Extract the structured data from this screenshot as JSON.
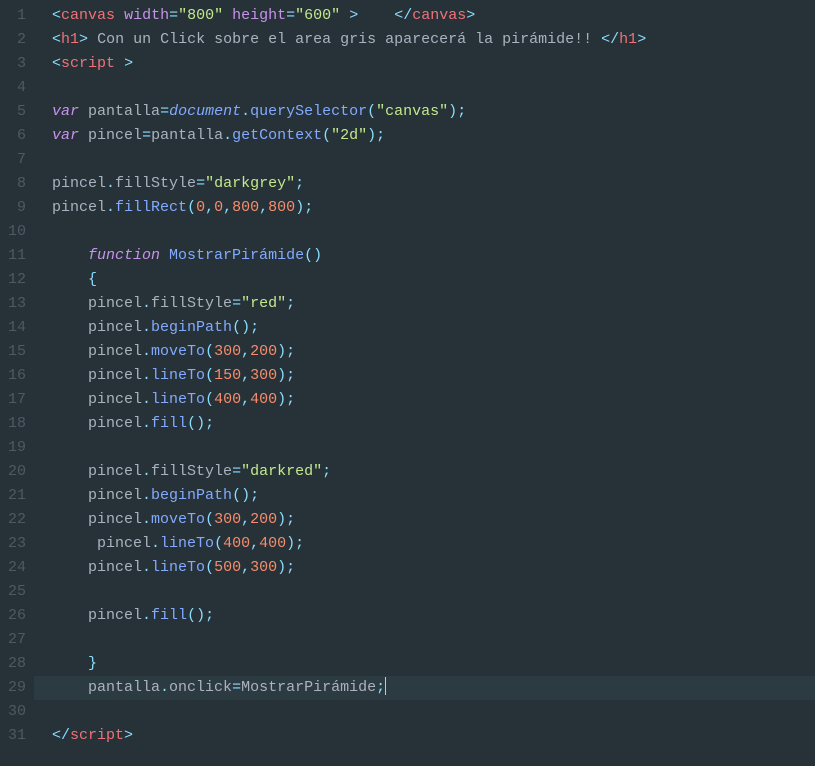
{
  "lineCount": 31,
  "currentLine": 29,
  "lines": [
    [
      [
        "ws",
        "  "
      ],
      [
        "punct",
        "<"
      ],
      [
        "tag",
        "canvas"
      ],
      [
        "text",
        " "
      ],
      [
        "attrn",
        "width"
      ],
      [
        "punct",
        "="
      ],
      [
        "string",
        "\"800\""
      ],
      [
        "text",
        " "
      ],
      [
        "attrn",
        "height"
      ],
      [
        "punct",
        "="
      ],
      [
        "string",
        "\"600\""
      ],
      [
        "text",
        " "
      ],
      [
        "punct",
        ">"
      ],
      [
        "text",
        "    "
      ],
      [
        "punct",
        "</"
      ],
      [
        "tag",
        "canvas"
      ],
      [
        "punct",
        ">"
      ]
    ],
    [
      [
        "ws",
        "  "
      ],
      [
        "punct",
        "<"
      ],
      [
        "tag",
        "h1"
      ],
      [
        "punct",
        ">"
      ],
      [
        "text",
        " Con un Click sobre el area gris aparecerá la pirámide!! "
      ],
      [
        "punct",
        "</"
      ],
      [
        "tag",
        "h1"
      ],
      [
        "punct",
        ">"
      ]
    ],
    [
      [
        "ws",
        "  "
      ],
      [
        "punct",
        "<"
      ],
      [
        "tag",
        "script"
      ],
      [
        "text",
        " "
      ],
      [
        "punct",
        ">"
      ]
    ],
    [],
    [
      [
        "ws",
        "  "
      ],
      [
        "kw",
        "var"
      ],
      [
        "text",
        " "
      ],
      [
        "def",
        "pantalla"
      ],
      [
        "punct",
        "="
      ],
      [
        "builtin",
        "document"
      ],
      [
        "punct",
        "."
      ],
      [
        "method",
        "querySelector"
      ],
      [
        "punct",
        "("
      ],
      [
        "string",
        "\"canvas\""
      ],
      [
        "punct",
        ")"
      ],
      [
        "punct",
        ";"
      ]
    ],
    [
      [
        "ws",
        "  "
      ],
      [
        "kw",
        "var"
      ],
      [
        "text",
        " "
      ],
      [
        "def",
        "pincel"
      ],
      [
        "punct",
        "="
      ],
      [
        "def",
        "pantalla"
      ],
      [
        "punct",
        "."
      ],
      [
        "method",
        "getContext"
      ],
      [
        "punct",
        "("
      ],
      [
        "string",
        "\"2d\""
      ],
      [
        "punct",
        ")"
      ],
      [
        "punct",
        ";"
      ]
    ],
    [],
    [
      [
        "ws",
        "  "
      ],
      [
        "def",
        "pincel"
      ],
      [
        "punct",
        "."
      ],
      [
        "prop",
        "fillStyle"
      ],
      [
        "punct",
        "="
      ],
      [
        "string",
        "\"darkgrey\""
      ],
      [
        "punct",
        ";"
      ]
    ],
    [
      [
        "ws",
        "  "
      ],
      [
        "def",
        "pincel"
      ],
      [
        "punct",
        "."
      ],
      [
        "method",
        "fillRect"
      ],
      [
        "punct",
        "("
      ],
      [
        "number",
        "0"
      ],
      [
        "punct",
        ","
      ],
      [
        "number",
        "0"
      ],
      [
        "punct",
        ","
      ],
      [
        "number",
        "800"
      ],
      [
        "punct",
        ","
      ],
      [
        "number",
        "800"
      ],
      [
        "punct",
        ")"
      ],
      [
        "punct",
        ";"
      ]
    ],
    [],
    [
      [
        "ws",
        "      "
      ],
      [
        "kw",
        "function"
      ],
      [
        "text",
        " "
      ],
      [
        "funcn",
        "MostrarPirámide"
      ],
      [
        "punct",
        "("
      ],
      [
        "punct",
        ")"
      ]
    ],
    [
      [
        "ws",
        "      "
      ],
      [
        "punct",
        "{"
      ]
    ],
    [
      [
        "ws",
        "      "
      ],
      [
        "def",
        "pincel"
      ],
      [
        "punct",
        "."
      ],
      [
        "prop",
        "fillStyle"
      ],
      [
        "punct",
        "="
      ],
      [
        "string",
        "\"red\""
      ],
      [
        "punct",
        ";"
      ]
    ],
    [
      [
        "ws",
        "      "
      ],
      [
        "def",
        "pincel"
      ],
      [
        "punct",
        "."
      ],
      [
        "method",
        "beginPath"
      ],
      [
        "punct",
        "("
      ],
      [
        "punct",
        ")"
      ],
      [
        "punct",
        ";"
      ]
    ],
    [
      [
        "ws",
        "      "
      ],
      [
        "def",
        "pincel"
      ],
      [
        "punct",
        "."
      ],
      [
        "method",
        "moveTo"
      ],
      [
        "punct",
        "("
      ],
      [
        "number",
        "300"
      ],
      [
        "punct",
        ","
      ],
      [
        "number",
        "200"
      ],
      [
        "punct",
        ")"
      ],
      [
        "punct",
        ";"
      ]
    ],
    [
      [
        "ws",
        "      "
      ],
      [
        "def",
        "pincel"
      ],
      [
        "punct",
        "."
      ],
      [
        "method",
        "lineTo"
      ],
      [
        "punct",
        "("
      ],
      [
        "number",
        "150"
      ],
      [
        "punct",
        ","
      ],
      [
        "number",
        "300"
      ],
      [
        "punct",
        ")"
      ],
      [
        "punct",
        ";"
      ]
    ],
    [
      [
        "ws",
        "      "
      ],
      [
        "def",
        "pincel"
      ],
      [
        "punct",
        "."
      ],
      [
        "method",
        "lineTo"
      ],
      [
        "punct",
        "("
      ],
      [
        "number",
        "400"
      ],
      [
        "punct",
        ","
      ],
      [
        "number",
        "400"
      ],
      [
        "punct",
        ")"
      ],
      [
        "punct",
        ";"
      ]
    ],
    [
      [
        "ws",
        "      "
      ],
      [
        "def",
        "pincel"
      ],
      [
        "punct",
        "."
      ],
      [
        "method",
        "fill"
      ],
      [
        "punct",
        "("
      ],
      [
        "punct",
        ")"
      ],
      [
        "punct",
        ";"
      ]
    ],
    [],
    [
      [
        "ws",
        "      "
      ],
      [
        "def",
        "pincel"
      ],
      [
        "punct",
        "."
      ],
      [
        "prop",
        "fillStyle"
      ],
      [
        "punct",
        "="
      ],
      [
        "string",
        "\"darkred\""
      ],
      [
        "punct",
        ";"
      ]
    ],
    [
      [
        "ws",
        "      "
      ],
      [
        "def",
        "pincel"
      ],
      [
        "punct",
        "."
      ],
      [
        "method",
        "beginPath"
      ],
      [
        "punct",
        "("
      ],
      [
        "punct",
        ")"
      ],
      [
        "punct",
        ";"
      ]
    ],
    [
      [
        "ws",
        "      "
      ],
      [
        "def",
        "pincel"
      ],
      [
        "punct",
        "."
      ],
      [
        "method",
        "moveTo"
      ],
      [
        "punct",
        "("
      ],
      [
        "number",
        "300"
      ],
      [
        "punct",
        ","
      ],
      [
        "number",
        "200"
      ],
      [
        "punct",
        ")"
      ],
      [
        "punct",
        ";"
      ]
    ],
    [
      [
        "ws",
        "       "
      ],
      [
        "def",
        "pincel"
      ],
      [
        "punct",
        "."
      ],
      [
        "method",
        "lineTo"
      ],
      [
        "punct",
        "("
      ],
      [
        "number",
        "400"
      ],
      [
        "punct",
        ","
      ],
      [
        "number",
        "400"
      ],
      [
        "punct",
        ")"
      ],
      [
        "punct",
        ";"
      ]
    ],
    [
      [
        "ws",
        "      "
      ],
      [
        "def",
        "pincel"
      ],
      [
        "punct",
        "."
      ],
      [
        "method",
        "lineTo"
      ],
      [
        "punct",
        "("
      ],
      [
        "number",
        "500"
      ],
      [
        "punct",
        ","
      ],
      [
        "number",
        "300"
      ],
      [
        "punct",
        ")"
      ],
      [
        "punct",
        ";"
      ]
    ],
    [],
    [
      [
        "ws",
        "      "
      ],
      [
        "def",
        "pincel"
      ],
      [
        "punct",
        "."
      ],
      [
        "method",
        "fill"
      ],
      [
        "punct",
        "("
      ],
      [
        "punct",
        ")"
      ],
      [
        "punct",
        ";"
      ]
    ],
    [],
    [
      [
        "ws",
        "      "
      ],
      [
        "punct",
        "}"
      ]
    ],
    [
      [
        "ws",
        "      "
      ],
      [
        "def",
        "pantalla"
      ],
      [
        "punct",
        "."
      ],
      [
        "prop",
        "onclick"
      ],
      [
        "punct",
        "="
      ],
      [
        "def",
        "MostrarPirámide"
      ],
      [
        "punct",
        ";"
      ],
      [
        "cursor",
        ""
      ]
    ],
    [],
    [
      [
        "ws",
        "  "
      ],
      [
        "punct",
        "</"
      ],
      [
        "tag",
        "script"
      ],
      [
        "punct",
        ">"
      ]
    ]
  ]
}
